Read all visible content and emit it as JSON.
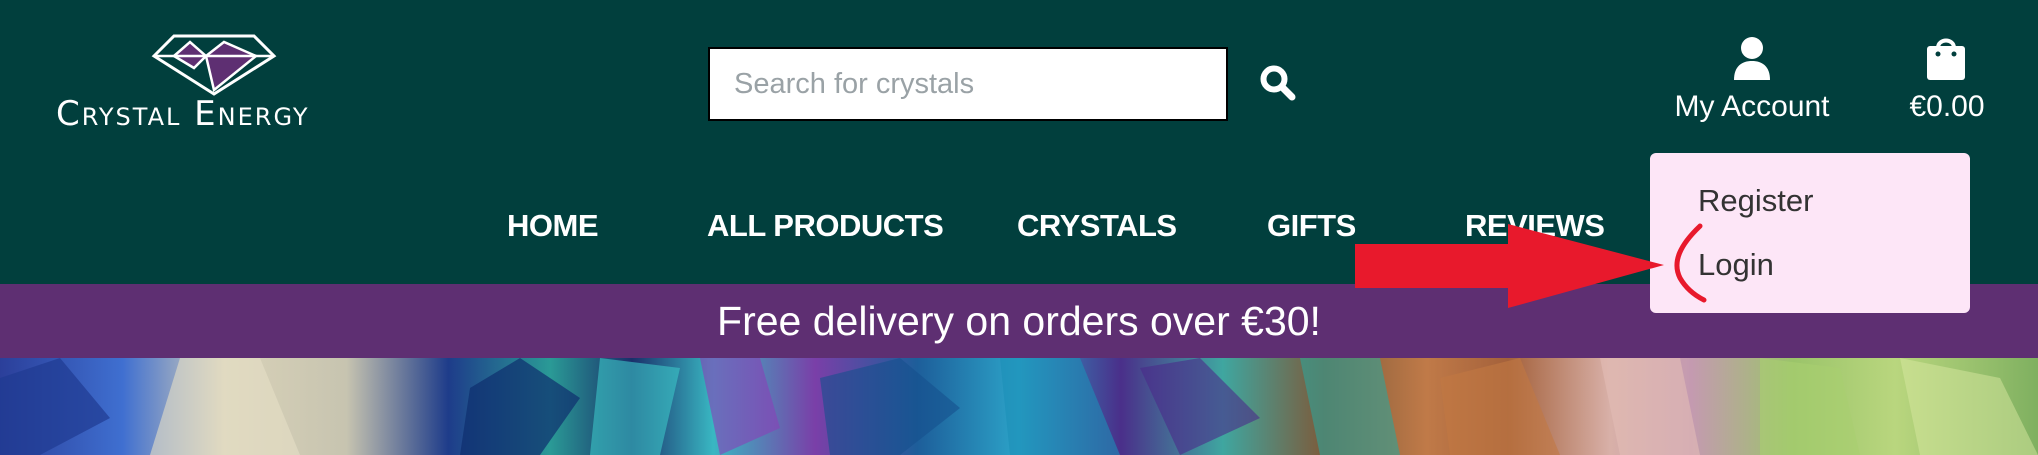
{
  "brand": {
    "name": "Crystal Energy"
  },
  "search": {
    "placeholder": "Search for crystals",
    "value": "",
    "icon": "search-icon"
  },
  "account": {
    "label": "My Account",
    "icon": "user-icon"
  },
  "cart": {
    "label": "€0.00",
    "icon": "shopping-bag-icon"
  },
  "nav": {
    "items": [
      {
        "label": "HOME"
      },
      {
        "label": "ALL PRODUCTS"
      },
      {
        "label": "CRYSTALS"
      },
      {
        "label": "GIFTS"
      },
      {
        "label": "REVIEWS"
      }
    ]
  },
  "account_menu": {
    "items": [
      {
        "label": "Register"
      },
      {
        "label": "Login"
      }
    ]
  },
  "banner": {
    "text": "Free delivery on orders over €30!"
  },
  "colors": {
    "header_bg": "#013f3d",
    "banner_bg": "#5e2f72",
    "dropdown_bg": "#fde6f7",
    "annotation_red": "#e8192c",
    "logo_accent": "#5e2f72"
  }
}
